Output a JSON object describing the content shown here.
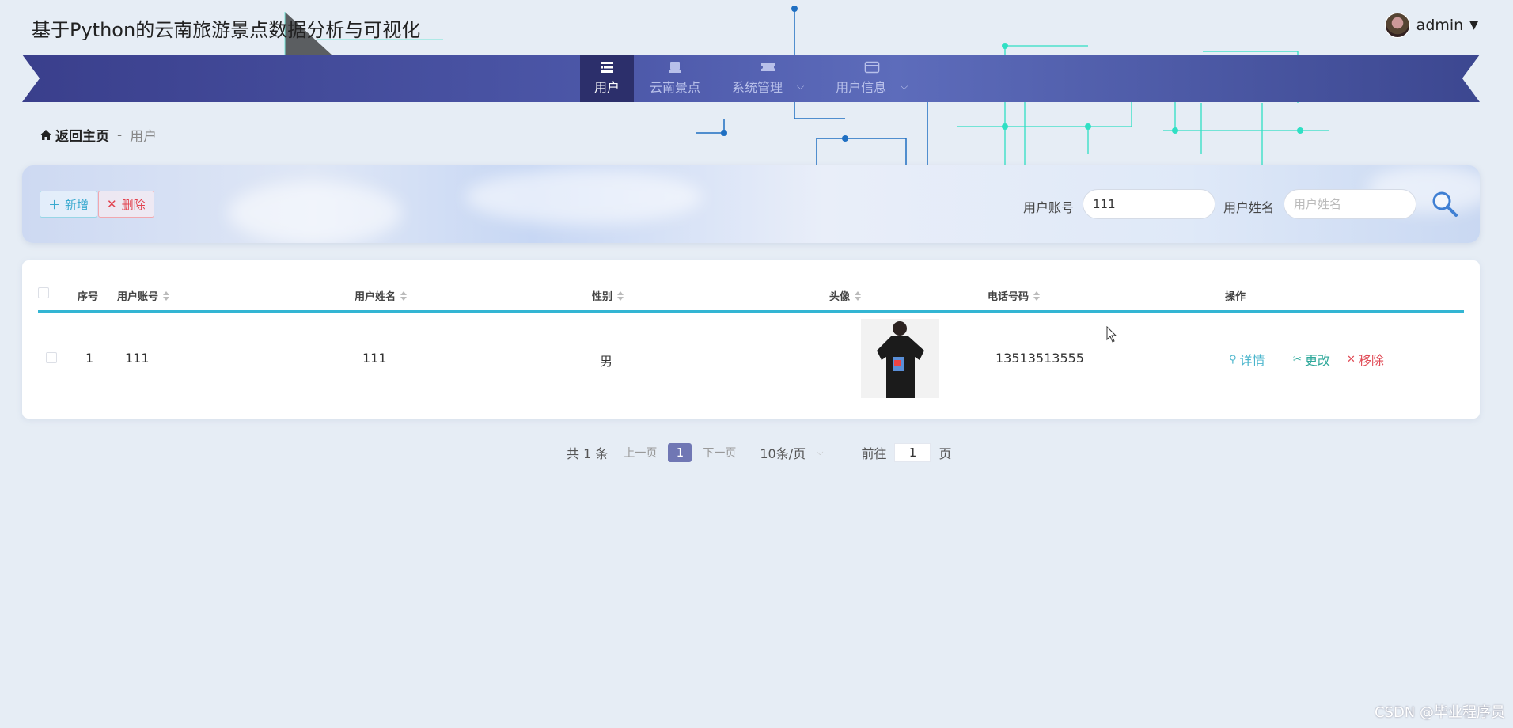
{
  "app": {
    "title": "基于Python的云南旅游景点数据分析与可视化"
  },
  "user": {
    "name": "admin"
  },
  "nav": {
    "items": [
      {
        "label": "用户",
        "icon": "list-icon",
        "active": true
      },
      {
        "label": "云南景点",
        "icon": "monitor-icon"
      },
      {
        "label": "系统管理",
        "icon": "ticket-icon",
        "has_dropdown": true
      },
      {
        "label": "用户信息",
        "icon": "card-icon",
        "has_dropdown": true
      }
    ]
  },
  "breadcrumb": {
    "home": "返回主页",
    "separator": "-",
    "current": "用户"
  },
  "toolbar": {
    "add_label": "新增",
    "delete_label": "删除"
  },
  "search": {
    "account_label": "用户账号",
    "account_value": "111",
    "name_label": "用户姓名",
    "name_placeholder": "用户姓名"
  },
  "table": {
    "columns": [
      "序号",
      "用户账号",
      "用户姓名",
      "性别",
      "头像",
      "电话号码",
      "操作"
    ],
    "rows": [
      {
        "index": "1",
        "account": "111",
        "name": "111",
        "gender": "男",
        "avatar": "photo",
        "phone": "13513513555"
      }
    ],
    "actions": {
      "detail": "详情",
      "edit": "更改",
      "remove": "移除"
    }
  },
  "pagination": {
    "total": "共 1 条",
    "prev": "上一页",
    "current": "1",
    "next": "下一页",
    "page_size": "10条/页",
    "goto_label": "前往",
    "goto_value": "1",
    "goto_suffix": "页"
  },
  "watermark": "CSDN @毕业程序员",
  "colors": {
    "accent": "#33b5d3",
    "nav": "#3a3f8c",
    "active_nav": "#2c2f6b",
    "danger": "#e2434f"
  }
}
